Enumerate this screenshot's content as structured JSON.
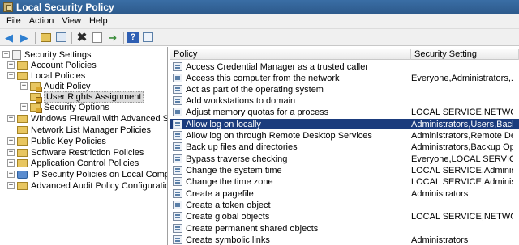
{
  "window": {
    "title": "Local Security Policy"
  },
  "menu": [
    {
      "label": "File"
    },
    {
      "label": "Action"
    },
    {
      "label": "View"
    },
    {
      "label": "Help"
    }
  ],
  "toolbar": {
    "icons": [
      "back-arrow-icon",
      "forward-arrow-icon",
      "up-folder-icon",
      "show-hide-tree-icon",
      "delete-icon",
      "properties-icon",
      "export-list-icon",
      "help-icon",
      "view-icon"
    ]
  },
  "tree": {
    "items": [
      {
        "label": "Security Settings",
        "icon": "security-settings-icon",
        "expander": "−"
      },
      {
        "label": "Account Policies",
        "icon": "folder-icon",
        "expander": "+"
      },
      {
        "label": "Local Policies",
        "icon": "folder-icon",
        "expander": "−"
      },
      {
        "label": "Audit Policy",
        "icon": "folder-lock-icon",
        "expander": "+"
      },
      {
        "label": "User Rights Assignment",
        "icon": "folder-lock-icon",
        "expander": ""
      },
      {
        "label": "Security Options",
        "icon": "folder-lock-icon",
        "expander": "+"
      },
      {
        "label": "Windows Firewall with Advanced Security",
        "icon": "folder-icon",
        "expander": "+"
      },
      {
        "label": "Network List Manager Policies",
        "icon": "folder-icon",
        "expander": ""
      },
      {
        "label": "Public Key Policies",
        "icon": "folder-icon",
        "expander": "+"
      },
      {
        "label": "Software Restriction Policies",
        "icon": "folder-icon",
        "expander": "+"
      },
      {
        "label": "Application Control Policies",
        "icon": "folder-icon",
        "expander": "+"
      },
      {
        "label": "IP Security Policies on Local Computer",
        "icon": "network-policy-icon",
        "expander": "+"
      },
      {
        "label": "Advanced Audit Policy Configuration",
        "icon": "folder-icon",
        "expander": "+"
      }
    ]
  },
  "list": {
    "columns": {
      "policy": "Policy",
      "setting": "Security Setting"
    },
    "rows": [
      {
        "policy": "Access Credential Manager as a trusted caller",
        "setting": ""
      },
      {
        "policy": "Access this computer from the network",
        "setting": "Everyone,Administrators,..."
      },
      {
        "policy": "Act as part of the operating system",
        "setting": ""
      },
      {
        "policy": "Add workstations to domain",
        "setting": ""
      },
      {
        "policy": "Adjust memory quotas for a process",
        "setting": "LOCAL SERVICE,NETWOR..."
      },
      {
        "policy": "Allow log on locally",
        "setting": "Administrators,Users,Back..."
      },
      {
        "policy": "Allow log on through Remote Desktop Services",
        "setting": "Administrators,Remote De..."
      },
      {
        "policy": "Back up files and directories",
        "setting": "Administrators,Backup Op..."
      },
      {
        "policy": "Bypass traverse checking",
        "setting": "Everyone,LOCAL SERVICE,..."
      },
      {
        "policy": "Change the system time",
        "setting": "LOCAL SERVICE,Administr..."
      },
      {
        "policy": "Change the time zone",
        "setting": "LOCAL SERVICE,Administr..."
      },
      {
        "policy": "Create a pagefile",
        "setting": "Administrators"
      },
      {
        "policy": "Create a token object",
        "setting": ""
      },
      {
        "policy": "Create global objects",
        "setting": "LOCAL SERVICE,NETWOR..."
      },
      {
        "policy": "Create permanent shared objects",
        "setting": ""
      },
      {
        "policy": "Create symbolic links",
        "setting": "Administrators"
      }
    ]
  },
  "colors": {
    "title_bar": "#2d5a8c",
    "selection": "#1b3c7d"
  }
}
